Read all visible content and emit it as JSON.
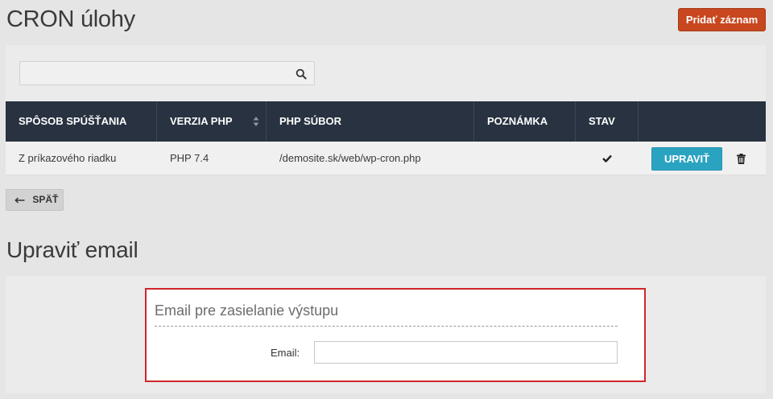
{
  "page": {
    "title": "CRON úlohy",
    "add_button_label": "Pridať záznam"
  },
  "search": {
    "value": "",
    "placeholder": ""
  },
  "table": {
    "headers": [
      "SPÔSOB SPÚŠŤANIA",
      "VERZIA PHP",
      "PHP SÚBOR",
      "POZNÁMKA",
      "STAV",
      ""
    ],
    "rows": [
      {
        "method": "Z príkazového riadku",
        "php_version": "PHP 7.4",
        "php_file": "/demosite.sk/web/wp-cron.php",
        "note": "",
        "status_icon": "check-icon",
        "edit_label": "UPRAVIŤ"
      }
    ]
  },
  "back_button_label": "SPÄŤ",
  "edit_email": {
    "title": "Upraviť email",
    "legend": "Email pre zasielanie výstupu",
    "email_label": "Email:",
    "email_value": "",
    "accent_color": "#d0262b"
  },
  "colors": {
    "primary_action": "#c8471f",
    "edit_button": "#2aa3c1",
    "table_header": "#283240"
  }
}
